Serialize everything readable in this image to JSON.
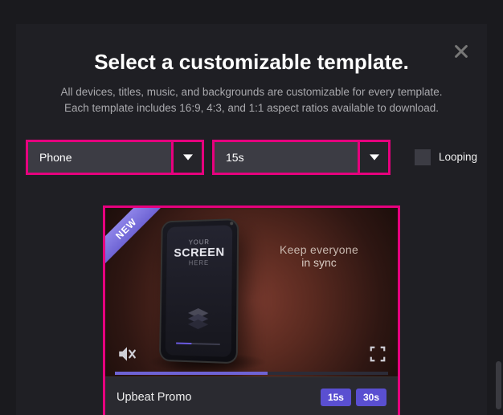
{
  "modal": {
    "title": "Select a customizable template.",
    "subtitle_line1": "All devices, titles, music, and backgrounds are customizable for every template.",
    "subtitle_line2": "Each template includes 16:9, 4:3, and 1:1 aspect ratios available to download."
  },
  "filters": {
    "device": "Phone",
    "duration": "15s",
    "looping_label": "Looping",
    "looping_checked": false
  },
  "template": {
    "name": "Upbeat Promo",
    "new_badge": "NEW",
    "tagline_line1": "Keep everyone",
    "tagline_line2": "in sync",
    "chips": [
      "15s",
      "30s"
    ],
    "mock": {
      "your": "YOUR",
      "screen": "SCREEN",
      "here": "HERE"
    },
    "progress_pct": 56
  }
}
